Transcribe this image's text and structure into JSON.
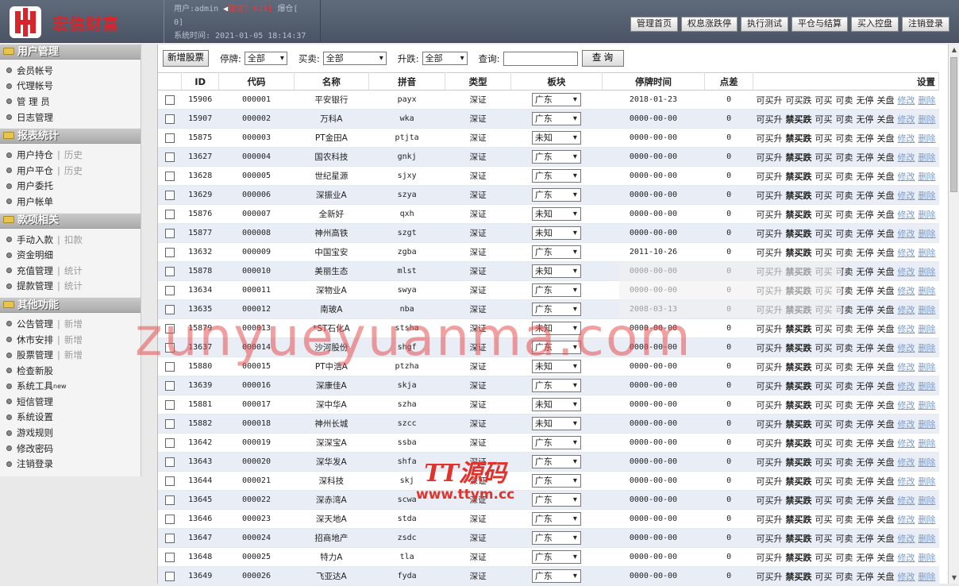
{
  "header": {
    "logo_text": "宏信财富",
    "user_label": "用户:admin",
    "sms_label": "短信[ 621]",
    "cang_label": "爆仓[",
    "cang_count": "0]",
    "time_label": "系统时间: 2021-01-05 18:14:37",
    "buttons": [
      "管理首页",
      "权息涨跌停",
      "执行测试",
      "平仓与结算",
      "买入控盘",
      "注销登录"
    ]
  },
  "sidebar": {
    "sections": [
      {
        "title": "用户管理",
        "items": [
          {
            "label": "会员帐号"
          },
          {
            "label": "代理帐号"
          },
          {
            "label": "管 理 员"
          },
          {
            "label": "日志管理"
          }
        ]
      },
      {
        "title": "报表统计",
        "items": [
          {
            "label": "用户持仓",
            "sub": "历史"
          },
          {
            "label": "用户平仓",
            "sub": "历史"
          },
          {
            "label": "用户委托"
          },
          {
            "label": "用户帐单"
          }
        ]
      },
      {
        "title": "款项相关",
        "items": [
          {
            "label": "手动入款",
            "sub": "扣款"
          },
          {
            "label": "资金明细"
          },
          {
            "label": "充值管理",
            "sub": "统计"
          },
          {
            "label": "提款管理",
            "sub": "统计"
          }
        ]
      },
      {
        "title": "其他功能",
        "items": [
          {
            "label": "公告管理",
            "sub": "新增"
          },
          {
            "label": "休市安排",
            "sub": "新增"
          },
          {
            "label": "股票管理",
            "sub": "新增"
          },
          {
            "label": "检查新股"
          },
          {
            "label": "系统工具",
            "new": "new"
          },
          {
            "label": "短信管理"
          },
          {
            "label": "系统设置"
          },
          {
            "label": "游戏规则"
          },
          {
            "label": "修改密码"
          },
          {
            "label": "注销登录"
          }
        ]
      }
    ]
  },
  "toolbar": {
    "add_button": "新增股票",
    "halt_label": "停牌:",
    "halt_value": "全部",
    "trade_label": "买卖:",
    "trade_value": "全部",
    "updown_label": "升跌:",
    "updown_value": "全部",
    "query_label": "查询:",
    "query_value": "",
    "query_button": "查 询"
  },
  "table": {
    "headers": [
      "ID",
      "代码",
      "名称",
      "拼音",
      "类型",
      "板块",
      "停牌时间",
      "点差",
      "设置"
    ],
    "rows": [
      {
        "id": "15906",
        "code": "000001",
        "name": "平安银行",
        "py": "payx",
        "type": "深证",
        "region": "广东",
        "halt": "2018-01-23",
        "spread": "0",
        "op2": "可买跌",
        "op2_bold": false
      },
      {
        "id": "15907",
        "code": "000002",
        "name": "万科A",
        "py": "wka",
        "type": "深证",
        "region": "广东",
        "halt": "0000-00-00",
        "spread": "0",
        "op2": "禁买跌",
        "op2_bold": true
      },
      {
        "id": "15875",
        "code": "000003",
        "name": "PT金田A",
        "py": "ptjta",
        "type": "深证",
        "region": "未知",
        "halt": "0000-00-00",
        "spread": "0",
        "op2": "禁买跌",
        "op2_bold": true
      },
      {
        "id": "13627",
        "code": "000004",
        "name": "国农科技",
        "py": "gnkj",
        "type": "深证",
        "region": "广东",
        "halt": "0000-00-00",
        "spread": "0",
        "op2": "禁买跌",
        "op2_bold": true
      },
      {
        "id": "13628",
        "code": "000005",
        "name": "世纪星源",
        "py": "sjxy",
        "type": "深证",
        "region": "广东",
        "halt": "0000-00-00",
        "spread": "0",
        "op2": "禁买跌",
        "op2_bold": true
      },
      {
        "id": "13629",
        "code": "000006",
        "name": "深振业A",
        "py": "szya",
        "type": "深证",
        "region": "广东",
        "halt": "0000-00-00",
        "spread": "0",
        "op2": "禁买跌",
        "op2_bold": true
      },
      {
        "id": "15876",
        "code": "000007",
        "name": "全新好",
        "py": "qxh",
        "type": "深证",
        "region": "未知",
        "halt": "0000-00-00",
        "spread": "0",
        "op2": "禁买跌",
        "op2_bold": true
      },
      {
        "id": "15877",
        "code": "000008",
        "name": "神州高铁",
        "py": "szgt",
        "type": "深证",
        "region": "未知",
        "halt": "0000-00-00",
        "spread": "0",
        "op2": "禁买跌",
        "op2_bold": true
      },
      {
        "id": "13632",
        "code": "000009",
        "name": "中国宝安",
        "py": "zgba",
        "type": "深证",
        "region": "广东",
        "halt": "2011-10-26",
        "spread": "0",
        "op2": "禁买跌",
        "op2_bold": true
      },
      {
        "id": "15878",
        "code": "000010",
        "name": "美丽生态",
        "py": "mlst",
        "type": "深证",
        "region": "未知",
        "halt": "0000-00-00",
        "spread": "0",
        "op2": "禁买跌",
        "op2_bold": true
      },
      {
        "id": "13634",
        "code": "000011",
        "name": "深物业A",
        "py": "swya",
        "type": "深证",
        "region": "广东",
        "halt": "0000-00-00",
        "spread": "0",
        "op2": "禁买跌",
        "op2_bold": true
      },
      {
        "id": "13635",
        "code": "000012",
        "name": "南玻A",
        "py": "nba",
        "type": "深证",
        "region": "广东",
        "halt": "2008-03-13",
        "spread": "0",
        "op2": "禁买跌",
        "op2_bold": true
      },
      {
        "id": "15879",
        "code": "000013",
        "name": "*ST石化A",
        "py": "stsha",
        "type": "深证",
        "region": "未知",
        "halt": "0000-00-00",
        "spread": "0",
        "op2": "禁买跌",
        "op2_bold": true
      },
      {
        "id": "13637",
        "code": "000014",
        "name": "沙河股份",
        "py": "shgf",
        "type": "深证",
        "region": "广东",
        "halt": "0000-00-00",
        "spread": "0",
        "op2": "禁买跌",
        "op2_bold": true
      },
      {
        "id": "15880",
        "code": "000015",
        "name": "PT中浩A",
        "py": "ptzha",
        "type": "深证",
        "region": "未知",
        "halt": "0000-00-00",
        "spread": "0",
        "op2": "禁买跌",
        "op2_bold": true
      },
      {
        "id": "13639",
        "code": "000016",
        "name": "深康佳A",
        "py": "skja",
        "type": "深证",
        "region": "广东",
        "halt": "0000-00-00",
        "spread": "0",
        "op2": "禁买跌",
        "op2_bold": true
      },
      {
        "id": "15881",
        "code": "000017",
        "name": "深中华A",
        "py": "szha",
        "type": "深证",
        "region": "未知",
        "halt": "0000-00-00",
        "spread": "0",
        "op2": "禁买跌",
        "op2_bold": true
      },
      {
        "id": "15882",
        "code": "000018",
        "name": "神州长城",
        "py": "szcc",
        "type": "深证",
        "region": "未知",
        "halt": "0000-00-00",
        "spread": "0",
        "op2": "禁买跌",
        "op2_bold": true
      },
      {
        "id": "13642",
        "code": "000019",
        "name": "深深宝A",
        "py": "ssba",
        "type": "深证",
        "region": "广东",
        "halt": "0000-00-00",
        "spread": "0",
        "op2": "禁买跌",
        "op2_bold": true
      },
      {
        "id": "13643",
        "code": "000020",
        "name": "深华发A",
        "py": "shfa",
        "type": "深证",
        "region": "广东",
        "halt": "0000-00-00",
        "spread": "0",
        "op2": "禁买跌",
        "op2_bold": true
      },
      {
        "id": "13644",
        "code": "000021",
        "name": "深科技",
        "py": "skj",
        "type": "深证",
        "region": "广东",
        "halt": "0000-00-00",
        "spread": "0",
        "op2": "禁买跌",
        "op2_bold": true
      },
      {
        "id": "13645",
        "code": "000022",
        "name": "深赤湾A",
        "py": "scwa",
        "type": "深证",
        "region": "广东",
        "halt": "0000-00-00",
        "spread": "0",
        "op2": "禁买跌",
        "op2_bold": true
      },
      {
        "id": "13646",
        "code": "000023",
        "name": "深天地A",
        "py": "stda",
        "type": "深证",
        "region": "广东",
        "halt": "0000-00-00",
        "spread": "0",
        "op2": "禁买跌",
        "op2_bold": true
      },
      {
        "id": "13647",
        "code": "000024",
        "name": "招商地产",
        "py": "zsdc",
        "type": "深证",
        "region": "广东",
        "halt": "0000-00-00",
        "spread": "0",
        "op2": "禁买跌",
        "op2_bold": true
      },
      {
        "id": "13648",
        "code": "000025",
        "name": "特力A",
        "py": "tla",
        "type": "深证",
        "region": "广东",
        "halt": "0000-00-00",
        "spread": "0",
        "op2": "禁买跌",
        "op2_bold": true
      },
      {
        "id": "13649",
        "code": "000026",
        "name": "飞亚达A",
        "py": "fyda",
        "type": "深证",
        "region": "广东",
        "halt": "0000-00-00",
        "spread": "0",
        "op2": "禁买跌",
        "op2_bold": true
      }
    ],
    "ops": {
      "buy_up": "可买升",
      "buy": "可买",
      "sell": "可卖",
      "no_halt": "无停",
      "close": "关盘",
      "edit": "修改",
      "delete": "删除"
    }
  },
  "watermark": {
    "main": "zunyueyuanma.com",
    "logo": "TT源码",
    "logo_url": "www.ttym.cc"
  }
}
